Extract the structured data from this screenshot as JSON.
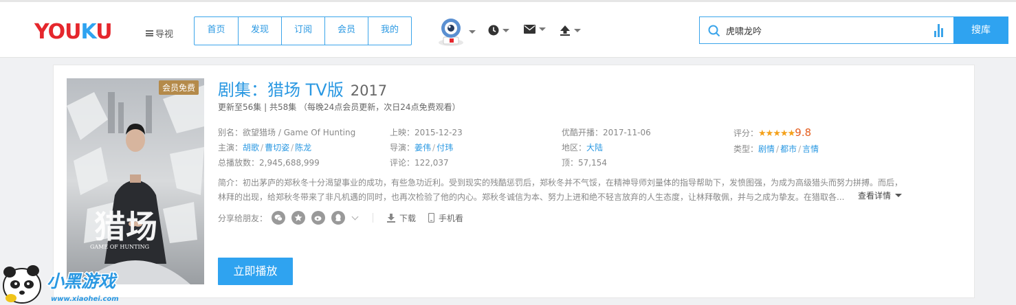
{
  "header": {
    "logo": {
      "part1": "YOU",
      "part2": "K",
      "part3": "U"
    },
    "guide_label": "导视",
    "nav": [
      "首页",
      "发现",
      "订阅",
      "会员",
      "我的"
    ],
    "search": {
      "value": "虎啸龙吟"
    },
    "search_button": "搜库"
  },
  "show": {
    "badge": "会员免费",
    "poster_title": "猎场",
    "poster_subtitle": "GAME OF HUNTING",
    "title": "剧集：猎场 TV版",
    "year": "2017",
    "update": "更新至56集 | 共58集 （每晚24点会员更新，次日24点免费观看）",
    "alias_label": "别名：",
    "alias": "欲望猎场 / Game Of Hunting",
    "release_label": "上映：",
    "release": "2015-12-23",
    "youku_label": "优酷开播：",
    "youku_date": "2017-11-06",
    "rating_label": "评分：",
    "rating_stars": "★★★★★",
    "rating": "9.8",
    "cast_label": "主演：",
    "cast": [
      "胡歌",
      "曹切姿",
      "陈龙"
    ],
    "director_label": "导演：",
    "directors": [
      "姜伟",
      "付玮"
    ],
    "region_label": "地区：",
    "region": "大陆",
    "genre_label": "类型：",
    "genres": [
      "剧情",
      "都市",
      "言情"
    ],
    "plays_label": "总播放数：",
    "plays": "2,945,688,999",
    "comments_label": "评论：",
    "comments": "122,037",
    "likes_label": "顶：",
    "likes": "57,154",
    "desc_line1": "简介：初出茅庐的郑秋冬十分渴望事业的成功，有些急功近利。受到现实的残酷惩罚后，郑秋冬并不气馁，在精神导师刘量体的指导帮助下，发愤图强，为成为高级猎头而努力拼搏。而后，",
    "desc_line2": "林拜的出现，给郑秋冬带来了非凡机遇的同时，也再次检验了他的内心。郑秋冬诚信为本、努力上进和绝不轻言放弃的人生态度，让林拜敬佩，并与之成为挚友。在猎取各...",
    "more_label": "查看详情",
    "share_label": "分享给朋友：",
    "download_label": "下载",
    "mobile_label": "手机看",
    "play_button": "立即播放"
  },
  "watermark": {
    "text": "小黑游戏",
    "url": "www.xiaohei.com"
  },
  "colors": {
    "brand_blue": "#2fa3f0",
    "logo_red": "#e5272d",
    "vip_gold": "#b48a4a",
    "star": "#f4a11b",
    "score": "#e45c1d"
  }
}
